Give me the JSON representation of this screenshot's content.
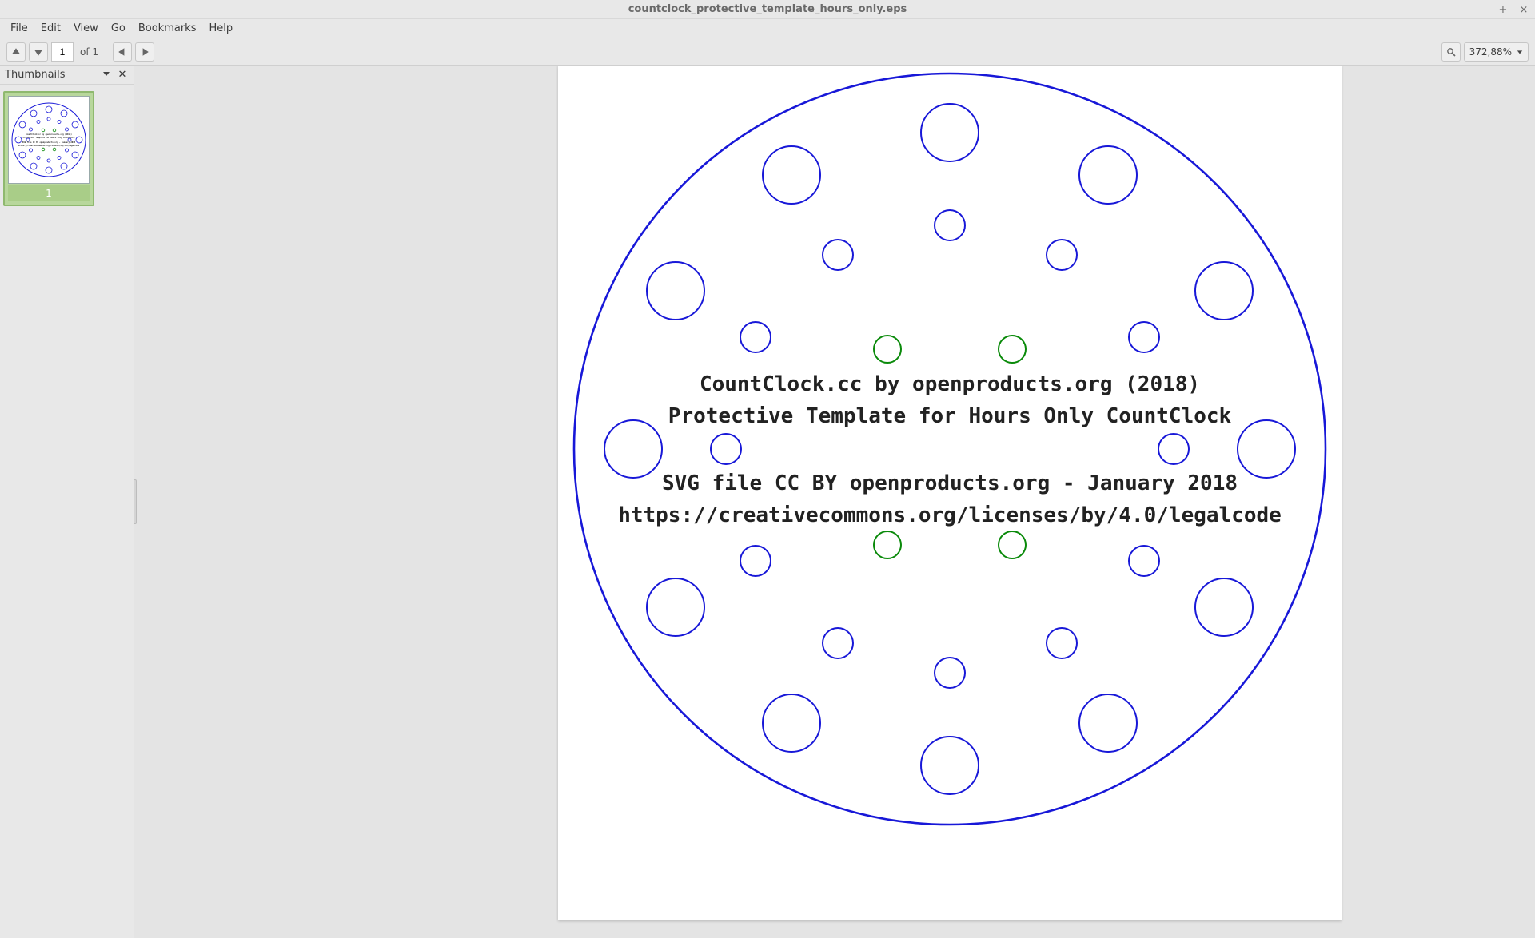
{
  "window": {
    "title": "countclock_protective_template_hours_only.eps"
  },
  "menu": {
    "items": [
      "File",
      "Edit",
      "View",
      "Go",
      "Bookmarks",
      "Help"
    ]
  },
  "toolbar": {
    "page_current": "1",
    "page_of": "of 1",
    "zoom_label": "372,88%"
  },
  "sidebar": {
    "title": "Thumbnails",
    "thumb_page": "1"
  },
  "document": {
    "line1": "CountClock.cc by openproducts.org (2018)",
    "line2": "Protective Template for Hours Only CountClock",
    "line3": "SVG file CC BY openproducts.org - January 2018",
    "line4": "https://creativecommons.org/licenses/by/4.0/legalcode"
  }
}
